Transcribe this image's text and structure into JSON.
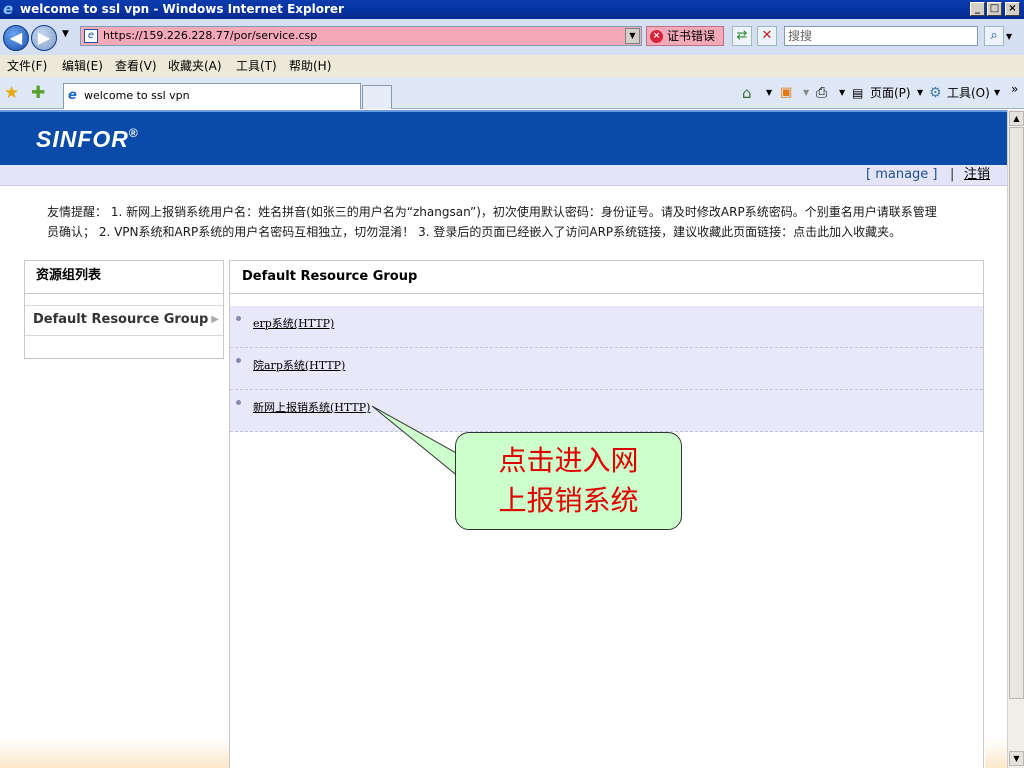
{
  "window": {
    "title": "welcome to ssl vpn - Windows Internet Explorer"
  },
  "address_bar": {
    "url": "https://159.226.228.77/por/service.csp",
    "cert_error": "证书错误",
    "search_placeholder": "搜搜"
  },
  "menu": {
    "items": [
      "文件(F)",
      "编辑(E)",
      "查看(V)",
      "收藏夹(A)",
      "工具(T)",
      "帮助(H)"
    ]
  },
  "tabs": {
    "active_tab": "welcome to ssl vpn"
  },
  "toolbar": {
    "page_label": "页面(P)",
    "tools_label": "工具(O)"
  },
  "page": {
    "logo": "SINFOR",
    "logo_mark": "®",
    "links": {
      "manage": "[ manage ]",
      "separator": "|",
      "logout": "注销"
    },
    "notice_line1": "友情提醒： 1. 新网上报销系统用户名：姓名拼音(如张三的用户名为“zhangsan”)，初次使用默认密码：身份证号。请及时修改ARP系统密码。个别重名用户请联系管理",
    "notice_line2": "员确认； 2. VPN系统和ARP系统的用户名密码互相独立，切勿混淆！ 3. 登录后的页面已经嵌入了访问ARP系统链接，建议收藏此页面链接：点击此加入收藏夹。",
    "left_panel": {
      "header": "资源组列表",
      "item": "Default Resource Group"
    },
    "main_panel": {
      "header": "Default Resource Group",
      "resources": [
        "erp系统(HTTP)",
        "院arp系统(HTTP)",
        "新网上报销系统(HTTP)"
      ]
    },
    "callout": {
      "line1": "点击进入网",
      "line2": "上报销系统"
    }
  }
}
